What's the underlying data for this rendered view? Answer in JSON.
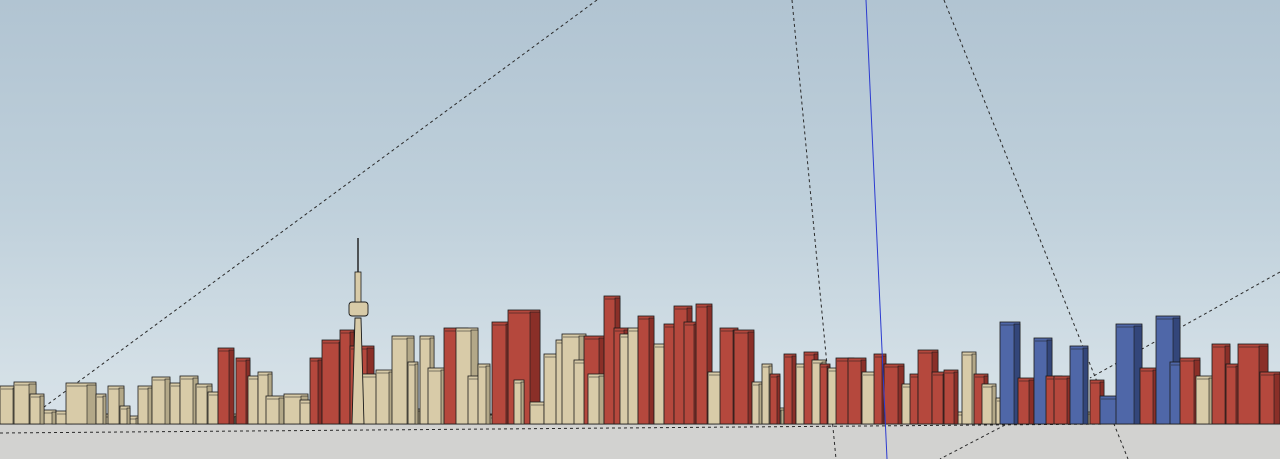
{
  "viewport": {
    "sky_top_color": "#b1c4d2",
    "sky_bottom_color": "#dbe4ea",
    "ground_color": "#d2d2d0"
  },
  "palette": {
    "context_building": "#d8cba8",
    "context_shade": "#b3a888",
    "proposed_building": "#b5483d",
    "proposed_shade": "#8a2f28",
    "highlight_building": "#4f67a8",
    "highlight_shade": "#33467a",
    "edge": "#1a1a1a",
    "blue_axis": "#2c3bd0",
    "guide_line": "#2a2a2a"
  },
  "scene": {
    "tower": "cn-tower",
    "guide_line_count": 6,
    "axis": "blue-vertical-axis"
  }
}
